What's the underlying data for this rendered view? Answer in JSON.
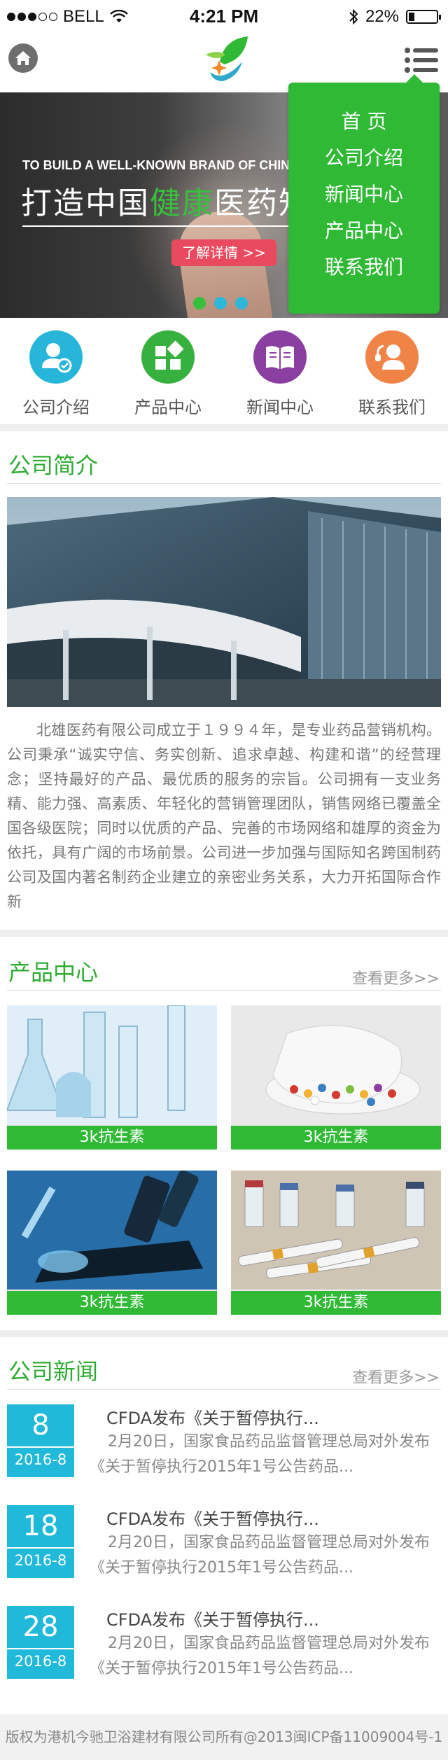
{
  "status_bar": {
    "carrier": "BELL",
    "time": "4:21 PM",
    "battery": "22%",
    "battery_level": 0.22
  },
  "header": {
    "home_icon": "home-icon",
    "logo_icon": "leaf-logo",
    "menu_icon": "menu-icon"
  },
  "banner": {
    "tagline_en": "TO BUILD A WELL-KNOWN BRAND OF CHINESE HEALTH MEDICINE",
    "headline_part1": "打造中国",
    "headline_green": "健康",
    "headline_part2": "医药知名品牌",
    "button_label": "了解详情 >>",
    "slides": 3,
    "active_slide": 1
  },
  "dropdown_menu": {
    "items": [
      "首  页",
      "公司介绍",
      "新闻中心",
      "产品中心",
      "联系我们"
    ]
  },
  "quick_nav": [
    {
      "label": "公司介绍",
      "icon": "company-icon",
      "color": "#27b6d9"
    },
    {
      "label": "产品中心",
      "icon": "product-grid-icon",
      "color": "#36b03e"
    },
    {
      "label": "新闻中心",
      "icon": "news-book-icon",
      "color": "#8b3fa0"
    },
    {
      "label": "联系我们",
      "icon": "contact-agent-icon",
      "color": "#f08447"
    }
  ],
  "about": {
    "title": "公司简介",
    "text": "北雄医药有限公司成立于１９９４年，是专业药品营销机构。公司秉承“诚实守信、务实创新、追求卓越、构建和谐”的经营理念；坚持最好的产品、最优质的服务的宗旨。公司拥有一支业务精、能力强、高素质、年轻化的营销管理团队，销售网络已覆盖全国各级医院；同时以优质的产品、完善的市场网络和雄厚的资金为依托，具有广阔的市场前景。公司进一步加强与国际知名跨国制药公司及国内著名制药企业建立的亲密业务关系，大力开拓国际合作新"
  },
  "products": {
    "title": "产品中心",
    "more": "查看更多>>",
    "items": [
      {
        "caption": "3k抗生素"
      },
      {
        "caption": "3k抗生素"
      },
      {
        "caption": "3k抗生素"
      },
      {
        "caption": "3k抗生素"
      }
    ]
  },
  "news": {
    "title": "公司新闻",
    "more": "查看更多>>",
    "items": [
      {
        "day": "8",
        "ym": "2016-8",
        "title": "CFDA发布《关于暂停执行...",
        "desc": "2月20日，国家食品药品监督管理总局对外发布《关于暂停执行2015年1号公告药品..."
      },
      {
        "day": "18",
        "ym": "2016-8",
        "title": "CFDA发布《关于暂停执行...",
        "desc": "2月20日，国家食品药品监督管理总局对外发布《关于暂停执行2015年1号公告药品..."
      },
      {
        "day": "28",
        "ym": "2016-8",
        "title": "CFDA发布《关于暂停执行...",
        "desc": "2月20日，国家食品药品监督管理总局对外发布《关于暂停执行2015年1号公告药品..."
      }
    ]
  },
  "footer": {
    "text": "版权为港机今驰卫浴建材有限公司所有@2013闽ICP备11009004号-1"
  }
}
